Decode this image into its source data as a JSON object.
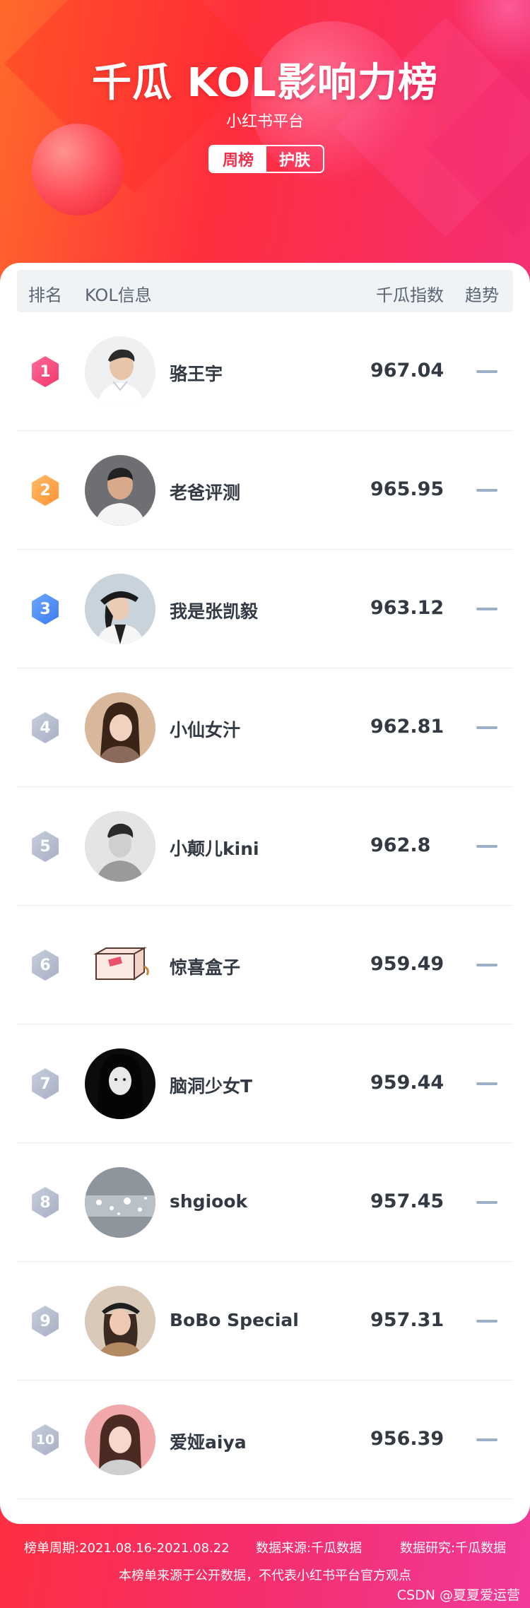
{
  "header": {
    "title": "千瓜 KOL影响力榜",
    "subtitle": "小红书平台",
    "tabs": [
      {
        "label": "周榜",
        "active": true
      },
      {
        "label": "护肤",
        "active": false
      }
    ]
  },
  "table": {
    "columns": {
      "rank": "排名",
      "kol": "KOL信息",
      "score": "千瓜指数",
      "trend": "趋势"
    },
    "rows": [
      {
        "rank": "1",
        "name": "骆王宇",
        "score": "967.04",
        "trend": "flat",
        "avatar": "portrait-man-white-shirt"
      },
      {
        "rank": "2",
        "name": "老爸评测",
        "score": "965.95",
        "trend": "flat",
        "avatar": "portrait-man-smiling"
      },
      {
        "rank": "3",
        "name": "我是张凯毅",
        "score": "963.12",
        "trend": "flat",
        "avatar": "portrait-woman-hat"
      },
      {
        "rank": "4",
        "name": "小仙女汁",
        "score": "962.81",
        "trend": "flat",
        "avatar": "portrait-woman-long-hair"
      },
      {
        "rank": "5",
        "name": "小颠儿kini",
        "score": "962.8",
        "trend": "flat",
        "avatar": "portrait-man-bw"
      },
      {
        "rank": "6",
        "name": "惊喜盒子",
        "score": "959.49",
        "trend": "flat",
        "avatar": "gift-box-illustration"
      },
      {
        "rank": "7",
        "name": "脑洞少女T",
        "score": "959.44",
        "trend": "flat",
        "avatar": "portrait-woman-bw"
      },
      {
        "rank": "8",
        "name": "shgiook",
        "score": "957.45",
        "trend": "flat",
        "avatar": "sparkle-texture"
      },
      {
        "rank": "9",
        "name": "BoBo Special",
        "score": "957.31",
        "trend": "flat",
        "avatar": "portrait-woman-cap"
      },
      {
        "rank": "10",
        "name": "爱娅aiya",
        "score": "956.39",
        "trend": "flat",
        "avatar": "portrait-woman-pink"
      }
    ]
  },
  "footer": {
    "period": "榜单周期:2021.08.16-2021.08.22",
    "source": "数据来源:千瓜数据",
    "research": "数据研究:千瓜数据",
    "disclaimer": "本榜单来源于公开数据，不代表小红书平台官方观点",
    "watermark": "CSDN @夏夏爱运营"
  },
  "colors": {
    "accent": "#f0314d",
    "rank1": "#f23468",
    "rank2": "#ff8f2e",
    "rank3": "#3a78f2",
    "rank_other": "#a6aec3",
    "trend_flat": "#9eb0c8"
  }
}
